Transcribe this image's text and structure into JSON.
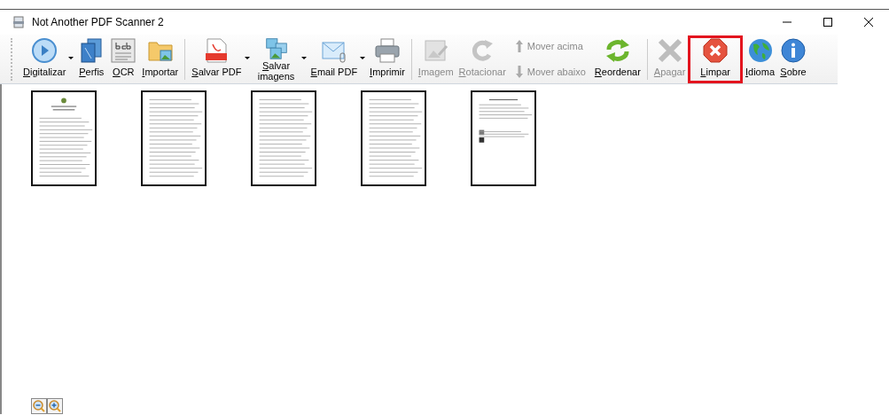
{
  "window": {
    "title": "Not Another PDF Scanner 2"
  },
  "toolbar": [
    {
      "kind": "button",
      "label": "Digitalizar",
      "dropdown": true,
      "disabled": false,
      "highlighted": false
    },
    {
      "kind": "button",
      "label": "Perfis",
      "dropdown": false,
      "disabled": false,
      "highlighted": false
    },
    {
      "kind": "button",
      "label": "OCR",
      "dropdown": false,
      "disabled": false,
      "highlighted": false
    },
    {
      "kind": "button",
      "label": "Importar",
      "dropdown": false,
      "disabled": false,
      "highlighted": false
    },
    {
      "kind": "separator"
    },
    {
      "kind": "button",
      "label": "Salvar PDF",
      "dropdown": true,
      "disabled": false,
      "highlighted": false
    },
    {
      "kind": "button",
      "label": "Salvar imagens",
      "dropdown": true,
      "disabled": false,
      "highlighted": false
    },
    {
      "kind": "button",
      "label": "Email PDF",
      "dropdown": true,
      "disabled": false,
      "highlighted": false
    },
    {
      "kind": "button",
      "label": "Imprimir",
      "dropdown": false,
      "disabled": false,
      "highlighted": false
    },
    {
      "kind": "separator"
    },
    {
      "kind": "button",
      "label": "Imagem",
      "dropdown": false,
      "disabled": true,
      "highlighted": false
    },
    {
      "kind": "button",
      "label": "Rotacionar",
      "dropdown": false,
      "disabled": true,
      "highlighted": false
    },
    {
      "kind": "move",
      "up": {
        "label": "Mover acima",
        "disabled": true
      },
      "down": {
        "label": "Mover abaixo",
        "disabled": true
      }
    },
    {
      "kind": "button",
      "label": "Reordenar",
      "dropdown": false,
      "disabled": false,
      "highlighted": false
    },
    {
      "kind": "separator"
    },
    {
      "kind": "button",
      "label": "Apagar",
      "dropdown": false,
      "disabled": true,
      "highlighted": false
    },
    {
      "kind": "button",
      "label": "Limpar",
      "dropdown": false,
      "disabled": false,
      "highlighted": true
    },
    {
      "kind": "button",
      "label": "Idioma",
      "dropdown": false,
      "disabled": false,
      "highlighted": false
    },
    {
      "kind": "button",
      "label": "Sobre",
      "dropdown": false,
      "disabled": false,
      "highlighted": false
    }
  ],
  "pages": [
    {
      "selected": false
    },
    {
      "selected": false
    },
    {
      "selected": false
    },
    {
      "selected": false
    },
    {
      "selected": false
    }
  ]
}
